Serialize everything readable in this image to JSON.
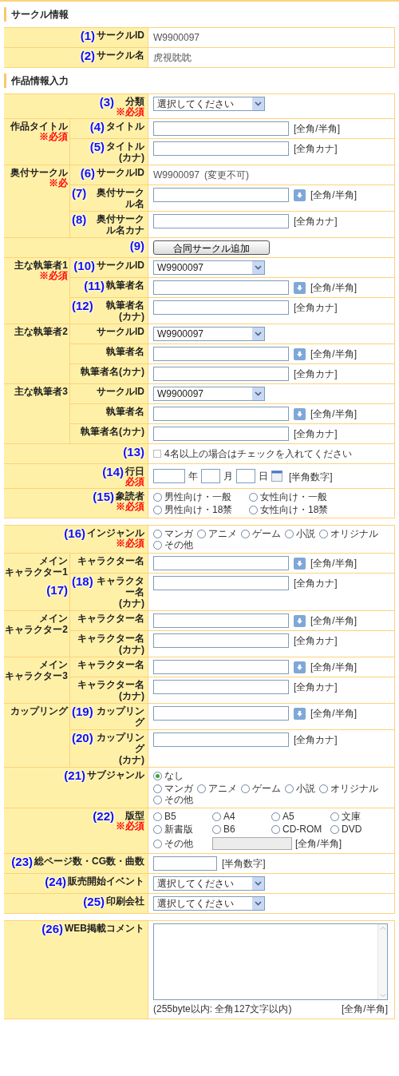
{
  "sections": [
    {
      "title": "サークル情報",
      "blocks": [
        {
          "rows": [
            {
              "callout": "(1)",
              "label": "サークルID",
              "controls": [
                {
                  "kind": "text",
                  "value": "W9900097"
                }
              ]
            }
          ]
        },
        {
          "rows": [
            {
              "callout": "(2)",
              "label": "サークル名",
              "controls": [
                {
                  "kind": "text",
                  "value": "虎視眈眈"
                }
              ]
            }
          ]
        }
      ]
    },
    {
      "title": "作品情報入力",
      "blocks": [
        {
          "rows": [
            {
              "callout": "(3)",
              "label": "分類",
              "required": "※必須",
              "controls": [
                {
                  "kind": "select",
                  "value": "選択してください"
                }
              ]
            }
          ]
        },
        {
          "group": {
            "label": "作品タイトル",
            "required": "※必須"
          },
          "rows": [
            {
              "callout": "(4)",
              "label": "タイトル",
              "controls": [
                {
                  "kind": "input",
                  "lookup": false,
                  "hint": "[全角/半角]"
                }
              ]
            },
            {
              "callout": "(5)",
              "label": "タイトル\n(カナ)",
              "controls": [
                {
                  "kind": "input",
                  "lookup": false,
                  "hint": "[全角カナ]"
                }
              ]
            }
          ]
        },
        {
          "group": {
            "label": "奥付サークル",
            "required": "※必"
          },
          "rows": [
            {
              "callout": "(6)",
              "label": "サークルID",
              "controls": [
                {
                  "kind": "text",
                  "value": "W9900097"
                },
                {
                  "kind": "note",
                  "value": "(変更不可)"
                }
              ]
            },
            {
              "callout": "(7)",
              "label": "奥付サークル名",
              "controls": [
                {
                  "kind": "input",
                  "lookup": true,
                  "hint": "[全角/半角]"
                }
              ]
            },
            {
              "callout": "(8)",
              "label": "奥付サークル名カナ",
              "controls": [
                {
                  "kind": "input",
                  "lookup": false,
                  "hint": "[全角カナ]"
                }
              ]
            }
          ]
        },
        {
          "rows": [
            {
              "callout": "(9)",
              "controls": [
                {
                  "kind": "button",
                  "label": "合同サークル追加"
                }
              ]
            }
          ]
        },
        {
          "group": {
            "label": "主な執筆者1",
            "required": "※必須"
          },
          "rows": [
            {
              "callout": "(10)",
              "label": "サークルID",
              "controls": [
                {
                  "kind": "select",
                  "value": "W9900097"
                }
              ]
            },
            {
              "callout": "(11)",
              "label": "執筆者名",
              "controls": [
                {
                  "kind": "input",
                  "lookup": true,
                  "hint": "[全角/半角]"
                }
              ]
            },
            {
              "callout": "(12)",
              "label": "執筆者名(カナ)",
              "controls": [
                {
                  "kind": "input",
                  "lookup": false,
                  "hint": "[全角カナ]"
                }
              ]
            }
          ]
        },
        {
          "group": {
            "label": "主な執筆者2"
          },
          "rows": [
            {
              "label": "サークルID",
              "controls": [
                {
                  "kind": "select",
                  "value": "W9900097"
                }
              ]
            },
            {
              "label": "執筆者名",
              "controls": [
                {
                  "kind": "input",
                  "lookup": true,
                  "hint": "[全角/半角]"
                }
              ]
            },
            {
              "label": "執筆者名(カナ)",
              "controls": [
                {
                  "kind": "input",
                  "lookup": false,
                  "hint": "[全角カナ]"
                }
              ]
            }
          ]
        },
        {
          "group": {
            "label": "主な執筆者3"
          },
          "rows": [
            {
              "label": "サークルID",
              "controls": [
                {
                  "kind": "select",
                  "value": "W9900097"
                }
              ]
            },
            {
              "label": "執筆者名",
              "controls": [
                {
                  "kind": "input",
                  "lookup": true,
                  "hint": "[全角/半角]"
                }
              ]
            },
            {
              "label": "執筆者名(カナ)",
              "controls": [
                {
                  "kind": "input",
                  "lookup": false,
                  "hint": "[全角カナ]"
                }
              ]
            }
          ]
        },
        {
          "rows": [
            {
              "callout": "(13)",
              "controls": [
                {
                  "kind": "checkbox",
                  "label": "4名以上の場合はチェックを入れてください",
                  "checked": false
                }
              ]
            }
          ]
        },
        {
          "rows": [
            {
              "callout": "(14)",
              "label": "行日",
              "required": "必須",
              "controls": [
                {
                  "kind": "date",
                  "parts": [
                    {
                      "unit": "年"
                    },
                    {
                      "unit": "月"
                    },
                    {
                      "unit": "日"
                    }
                  ],
                  "hint": "[半角数字]"
                }
              ]
            }
          ]
        },
        {
          "rows": [
            {
              "callout": "(15)",
              "label": "象読者",
              "required": "※必須",
              "controls": [
                {
                  "kind": "radios",
                  "option_rows": [
                    [
                      {
                        "kind": "radio",
                        "label": "男性向け・一般",
                        "selected": false
                      },
                      {
                        "kind": "radio",
                        "label": "女性向け・一般",
                        "selected": false
                      }
                    ],
                    [
                      {
                        "kind": "radio",
                        "label": "男性向け・18禁",
                        "selected": false
                      },
                      {
                        "kind": "radio",
                        "label": "女性向け・18禁",
                        "selected": false
                      }
                    ]
                  ]
                }
              ]
            }
          ]
        }
      ]
    },
    {
      "blocks": [
        {
          "rows": [
            {
              "callout": "(16)",
              "label": "インジャンル",
              "required": "※必須",
              "controls": [
                {
                  "kind": "radios",
                  "option_rows": [
                    [
                      {
                        "kind": "radio",
                        "label": "マンガ",
                        "selected": false
                      },
                      {
                        "kind": "radio",
                        "label": "アニメ",
                        "selected": false
                      },
                      {
                        "kind": "radio",
                        "label": "ゲーム",
                        "selected": false
                      },
                      {
                        "kind": "radio",
                        "label": "小説",
                        "selected": false
                      },
                      {
                        "kind": "radio",
                        "label": "オリジナル",
                        "selected": false
                      },
                      {
                        "kind": "radio",
                        "label": "その他",
                        "selected": false
                      }
                    ]
                  ]
                }
              ]
            }
          ]
        },
        {
          "group": {
            "label_lines": [
              "メイン",
              "キャラクター1"
            ],
            "callout": "(17)"
          },
          "rows": [
            {
              "label": "キャラクター名",
              "controls": [
                {
                  "kind": "input",
                  "lookup": true,
                  "hint": "[全角/半角]"
                }
              ]
            },
            {
              "callout": "(18)",
              "label": "キャラクター名\n(カナ)",
              "controls": [
                {
                  "kind": "input",
                  "lookup": false,
                  "hint": "[全角カナ]"
                }
              ]
            }
          ]
        },
        {
          "group": {
            "label_lines": [
              "メイン",
              "キャラクター2"
            ]
          },
          "rows": [
            {
              "label": "キャラクター名",
              "controls": [
                {
                  "kind": "input",
                  "lookup": true,
                  "hint": "[全角/半角]"
                }
              ]
            },
            {
              "label": "キャラクター名\n(カナ)",
              "controls": [
                {
                  "kind": "input",
                  "lookup": false,
                  "hint": "[全角カナ]"
                }
              ]
            }
          ]
        },
        {
          "group": {
            "label_lines": [
              "メイン",
              "キャラクター3"
            ]
          },
          "rows": [
            {
              "label": "キャラクター名",
              "controls": [
                {
                  "kind": "input",
                  "lookup": true,
                  "hint": "[全角/半角]"
                }
              ]
            },
            {
              "label": "キャラクター名\n(カナ)",
              "controls": [
                {
                  "kind": "input",
                  "lookup": false,
                  "hint": "[全角カナ]"
                }
              ]
            }
          ]
        },
        {
          "group": {
            "label": "カップリング"
          },
          "rows": [
            {
              "callout": "(19)",
              "label": "カップリング",
              "controls": [
                {
                  "kind": "input",
                  "lookup": true,
                  "hint": "[全角/半角]"
                }
              ]
            },
            {
              "callout": "(20)",
              "label": "カップリング\n(カナ)",
              "controls": [
                {
                  "kind": "input",
                  "lookup": false,
                  "hint": "[全角カナ]"
                }
              ]
            }
          ]
        },
        {
          "rows": [
            {
              "callout": "(21)",
              "label": "サブジャンル",
              "controls": [
                {
                  "kind": "radios",
                  "option_rows": [
                    [
                      {
                        "kind": "radio",
                        "label": "なし",
                        "selected": true
                      }
                    ],
                    [
                      {
                        "kind": "radio",
                        "label": "マンガ",
                        "selected": false
                      },
                      {
                        "kind": "radio",
                        "label": "アニメ",
                        "selected": false
                      },
                      {
                        "kind": "radio",
                        "label": "ゲーム",
                        "selected": false
                      },
                      {
                        "kind": "radio",
                        "label": "小説",
                        "selected": false
                      },
                      {
                        "kind": "radio",
                        "label": "オリジナル",
                        "selected": false
                      },
                      {
                        "kind": "radio",
                        "label": "その他",
                        "selected": false
                      }
                    ]
                  ]
                }
              ]
            }
          ]
        },
        {
          "rows": [
            {
              "callout": "(22)",
              "label": "版型",
              "required": "※必須",
              "controls": [
                {
                  "kind": "radios",
                  "grid": true,
                  "option_rows": [
                    [
                      {
                        "kind": "radio",
                        "label": "B5",
                        "selected": false
                      },
                      {
                        "kind": "radio",
                        "label": "A4",
                        "selected": false
                      },
                      {
                        "kind": "radio",
                        "label": "A5",
                        "selected": false
                      },
                      {
                        "kind": "radio",
                        "label": "文庫",
                        "selected": false
                      }
                    ],
                    [
                      {
                        "kind": "radio",
                        "label": "新書版",
                        "selected": false
                      },
                      {
                        "kind": "radio",
                        "label": "B6",
                        "selected": false
                      },
                      {
                        "kind": "radio",
                        "label": "CD-ROM",
                        "selected": false
                      },
                      {
                        "kind": "radio",
                        "label": "DVD",
                        "selected": false
                      }
                    ],
                    [
                      {
                        "kind": "radio",
                        "label": "その他",
                        "selected": false
                      },
                      {
                        "kind": "field",
                        "disabled": true
                      },
                      {
                        "kind": "hint",
                        "text": "[全角/半角]"
                      }
                    ]
                  ]
                }
              ]
            }
          ]
        },
        {
          "rows": [
            {
              "callout": "(23)",
              "label": "総ページ数・CG数・曲数",
              "controls": [
                {
                  "kind": "input",
                  "lookup": false,
                  "short": true,
                  "hint": "[半角数字]"
                }
              ]
            }
          ]
        },
        {
          "rows": [
            {
              "callout": "(24)",
              "label": "販売開始イベント",
              "controls": [
                {
                  "kind": "select",
                  "value": "選択してください"
                }
              ]
            }
          ]
        },
        {
          "rows": [
            {
              "callout": "(25)",
              "label": "印刷会社",
              "controls": [
                {
                  "kind": "select",
                  "value": "選択してください"
                }
              ]
            }
          ]
        }
      ]
    },
    {
      "blocks": [
        {
          "rows": [
            {
              "callout": "(26)",
              "label": "WEB掲載コメント",
              "controls": [
                {
                  "kind": "textarea",
                  "note": "(255byte以内: 全角127文字以内)",
                  "hint": "[全角/半角]"
                }
              ]
            }
          ]
        }
      ]
    }
  ]
}
